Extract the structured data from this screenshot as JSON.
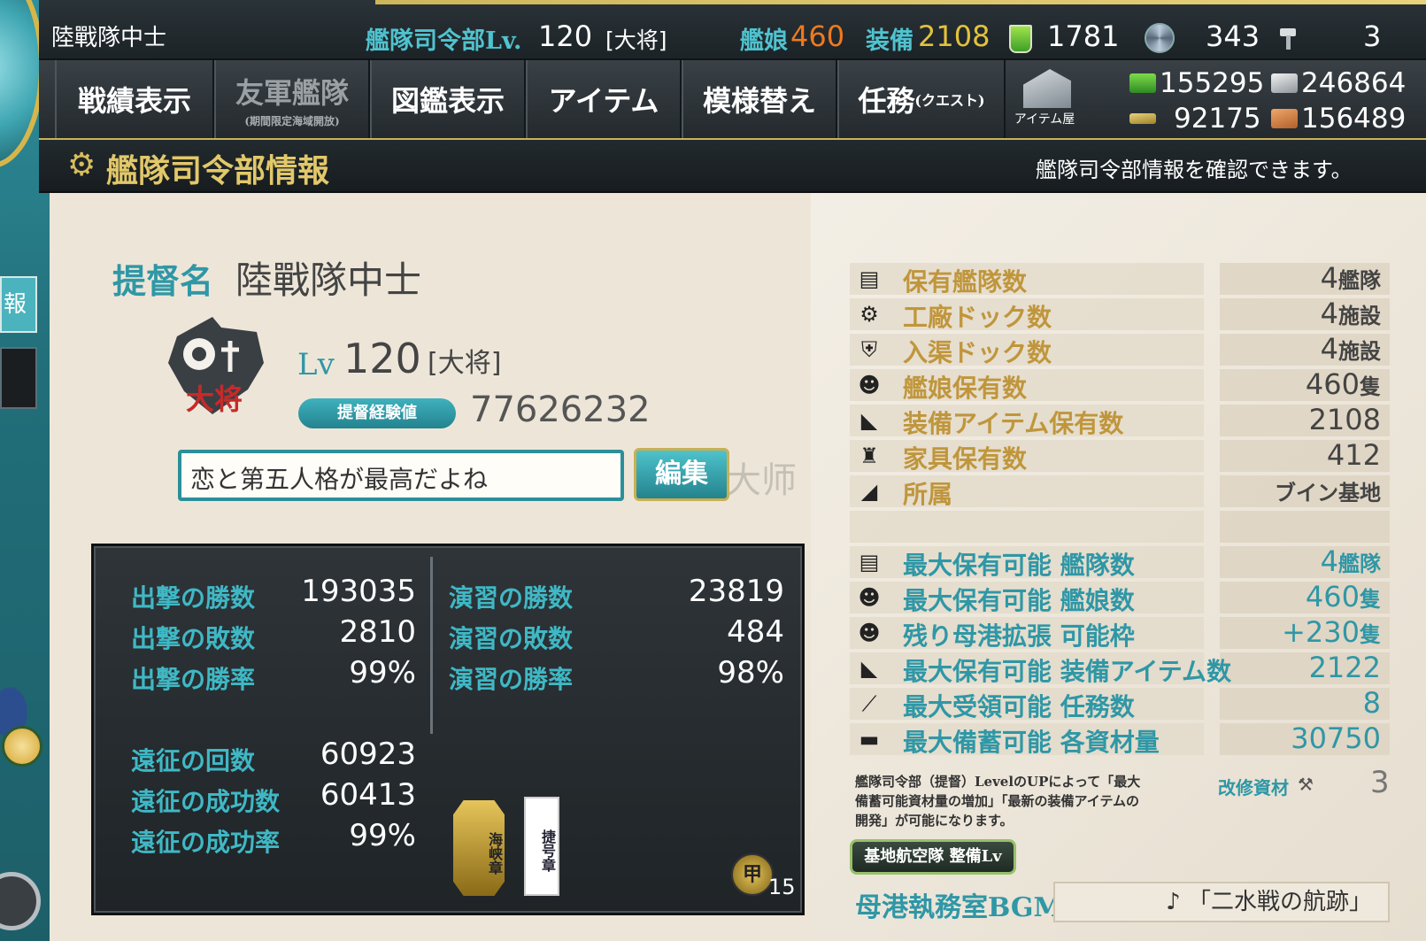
{
  "topbar": {
    "player_name": "陸戰隊中士",
    "hq_label": "艦隊司令部Lv.",
    "hq_level": "120",
    "hq_rank": "[大将]",
    "ship_label": "艦娘",
    "ship_count": "460",
    "equip_label": "装備",
    "equip_count": "2108",
    "bucket_count": "1781",
    "devmat_count": "343",
    "screw_count": "3"
  },
  "menu": {
    "items": [
      {
        "label": "戦績表示",
        "sub": ""
      },
      {
        "label": "友軍艦隊",
        "sub": "(期間限定海域開放)"
      },
      {
        "label": "図鑑表示",
        "sub": ""
      },
      {
        "label": "アイテム",
        "sub": ""
      },
      {
        "label": "模様替え",
        "sub": ""
      },
      {
        "label": "任務",
        "sub": "(クエスト)"
      }
    ],
    "item_shop_label": "アイテム屋",
    "resources": {
      "fuel": "155295",
      "ammo": "246864",
      "steel": "92175",
      "bauxite": "156489"
    }
  },
  "left": {
    "tab_label": "報"
  },
  "title": {
    "text": "艦隊司令部情報",
    "description": "艦隊司令部情報を確認できます。"
  },
  "profile": {
    "admiral_label": "提督名",
    "admiral_name": "陸戰隊中士",
    "emblem_text": "大将",
    "lv_label": "Lv",
    "level": "120",
    "rank": "[大将]",
    "exp_label": "提督経験値",
    "exp_value": "77626232",
    "comment": "恋と第五人格が最高だよね",
    "edit_label": "編集"
  },
  "stats": {
    "sortie": [
      {
        "label": "出撃の勝数",
        "value": "193035"
      },
      {
        "label": "出撃の敗数",
        "value": "2810"
      },
      {
        "label": "出撃の勝率",
        "value": "99%"
      }
    ],
    "exercise": [
      {
        "label": "演習の勝数",
        "value": "23819"
      },
      {
        "label": "演習の敗数",
        "value": "484"
      },
      {
        "label": "演習の勝率",
        "value": "98%"
      }
    ],
    "expedition": [
      {
        "label": "遠征の回数",
        "value": "60923"
      },
      {
        "label": "遠征の成功数",
        "value": "60413"
      },
      {
        "label": "遠征の成功率",
        "value": "99%"
      }
    ],
    "medals": {
      "medal1": "海峡章",
      "medal2": "捷号章",
      "medal3": "甲",
      "medal3_count": "15"
    }
  },
  "info": {
    "rows": [
      {
        "icon": "fleet-icon",
        "glyph": "▤",
        "label": "保有艦隊数",
        "value": "4",
        "unit": "艦隊",
        "blue": false
      },
      {
        "icon": "gear-icon",
        "glyph": "⚙",
        "label": "工廠ドック数",
        "value": "4",
        "unit": "施設",
        "blue": false
      },
      {
        "icon": "repair-icon",
        "glyph": "⛨",
        "label": "入渠ドック数",
        "value": "4",
        "unit": "施設",
        "blue": false
      },
      {
        "icon": "shipgirl-icon",
        "glyph": "☻",
        "label": "艦娘保有数",
        "value": "460",
        "unit": "隻",
        "blue": false
      },
      {
        "icon": "equipment-icon",
        "glyph": "◣",
        "label": "装備アイテム保有数",
        "value": "2108",
        "unit": "",
        "blue": false
      },
      {
        "icon": "furniture-icon",
        "glyph": "♜",
        "label": "家具保有数",
        "value": "412",
        "unit": "",
        "blue": false
      },
      {
        "icon": "base-icon",
        "glyph": "◢",
        "label": "所属",
        "value": "",
        "unit": "ブイン基地",
        "blue": false
      },
      {
        "icon": "",
        "glyph": "",
        "label": "",
        "value": "",
        "unit": "",
        "blue": false
      },
      {
        "icon": "fleet-icon",
        "glyph": "▤",
        "label": "最大保有可能 艦隊数",
        "value": "4",
        "unit": "艦隊",
        "blue": true
      },
      {
        "icon": "shipgirl-icon",
        "glyph": "☻",
        "label": "最大保有可能 艦娘数",
        "value": "460",
        "unit": "隻",
        "blue": true
      },
      {
        "icon": "shipgirl-icon",
        "glyph": "☻",
        "label": "残り母港拡張 可能枠",
        "value": "+230",
        "unit": "隻",
        "blue": true
      },
      {
        "icon": "equipment-icon",
        "glyph": "◣",
        "label": "最大保有可能 装備アイテム数",
        "value": "2122",
        "unit": "",
        "blue": true
      },
      {
        "icon": "quest-icon",
        "glyph": "⟋",
        "label": "最大受領可能 任務数",
        "value": "8",
        "unit": "",
        "blue": true
      },
      {
        "icon": "storage-icon",
        "glyph": "▬",
        "label": "最大備蓄可能 各資材量",
        "value": "30750",
        "unit": "",
        "blue": true
      }
    ],
    "note": "艦隊司令部（提督）LevelのUPによって「最大備蓄可能資材量の増加」「最新の装備アイテムの開発」が可能になります。",
    "kaishu_label": "改修資材",
    "kaishu_value": "3",
    "base_button": "基地航空隊 整備Lv",
    "bgm_label": "母港執務室BGM",
    "bgm_value": "♪ 「二水戦の航跡」"
  },
  "watermark": "大师",
  "colors": {
    "accent_teal": "#2f97a6",
    "gold": "#c0963c",
    "orange": "#f07a1e"
  }
}
